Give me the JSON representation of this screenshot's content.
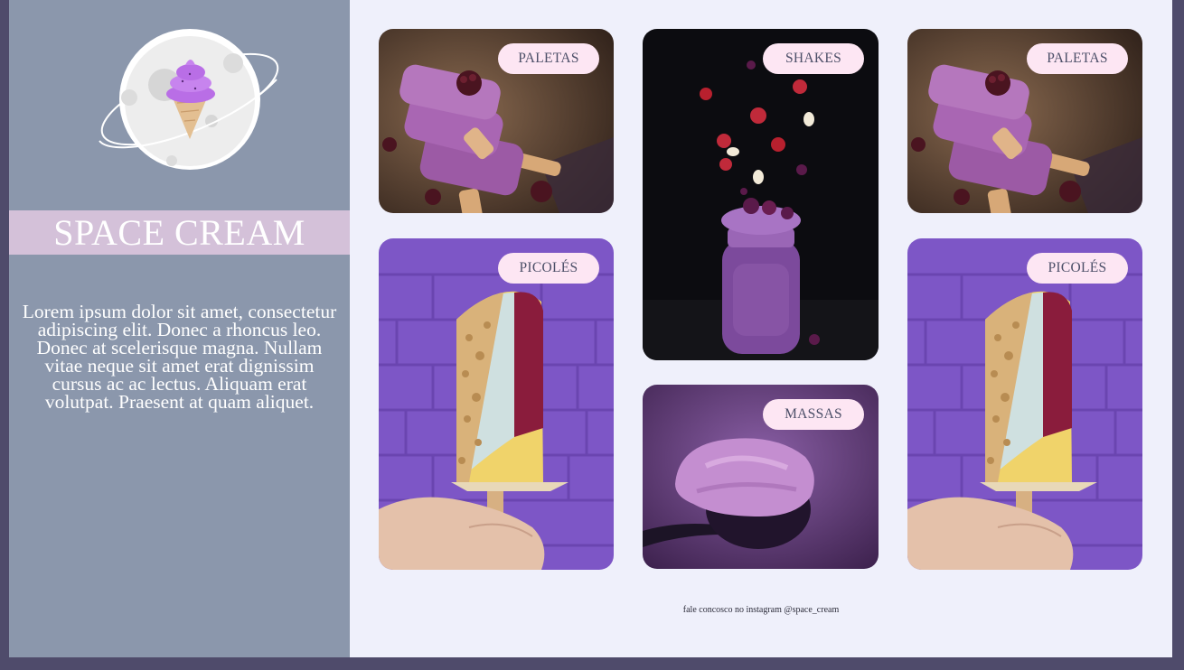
{
  "brand": {
    "title": "SPACE CREAM",
    "description": "Lorem ipsum dolor sit amet, consectetur adipiscing elit. Donec a rhoncus leo. Donec at scelerisque magna. Nullam vitae neque sit amet erat dignissim cursus ac ac lectus. Aliquam erat volutpat. Praesent at quam aliquet."
  },
  "colors": {
    "sidebar": "#8b97ac",
    "brand_bar": "#d4c1d9",
    "main_bg": "#eff0fb",
    "tag_bg": "#fde6f3",
    "frame": "#4f4b6b"
  },
  "cards": [
    {
      "label": "PALETAS",
      "image": "paleta-popsicle-photo"
    },
    {
      "label": "SHAKES",
      "image": "berry-shake-jar-photo"
    },
    {
      "label": "PALETAS",
      "image": "paleta-popsicle-photo"
    },
    {
      "label": "PICOLÉS",
      "image": "picole-on-purple-wall-photo"
    },
    {
      "label": "MASSAS",
      "image": "ice-cream-scoop-photo"
    },
    {
      "label": "PICOLÉS",
      "image": "picole-on-purple-wall-photo"
    }
  ],
  "footer": {
    "text": "fale concosco no instagram @space_cream"
  }
}
